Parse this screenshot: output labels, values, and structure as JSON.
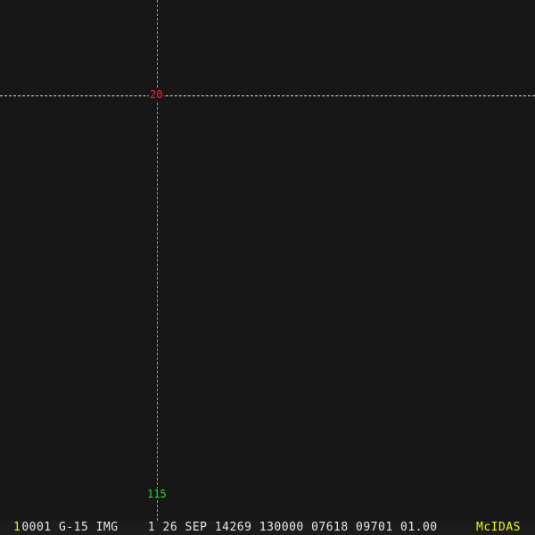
{
  "overlay": {
    "latitude_label": "20",
    "longitude_label": "115",
    "colors": {
      "lat_line": "#d8d8d8",
      "lon_line": "#22c8d8",
      "lat_label": "#ff2020",
      "lon_label": "#20e020"
    }
  },
  "status_bar": {
    "frame_number": "1",
    "info": "0001 G-15 IMG    1 26 SEP 14269 130000 07618 09701 01.00",
    "brand": "McIDAS"
  }
}
